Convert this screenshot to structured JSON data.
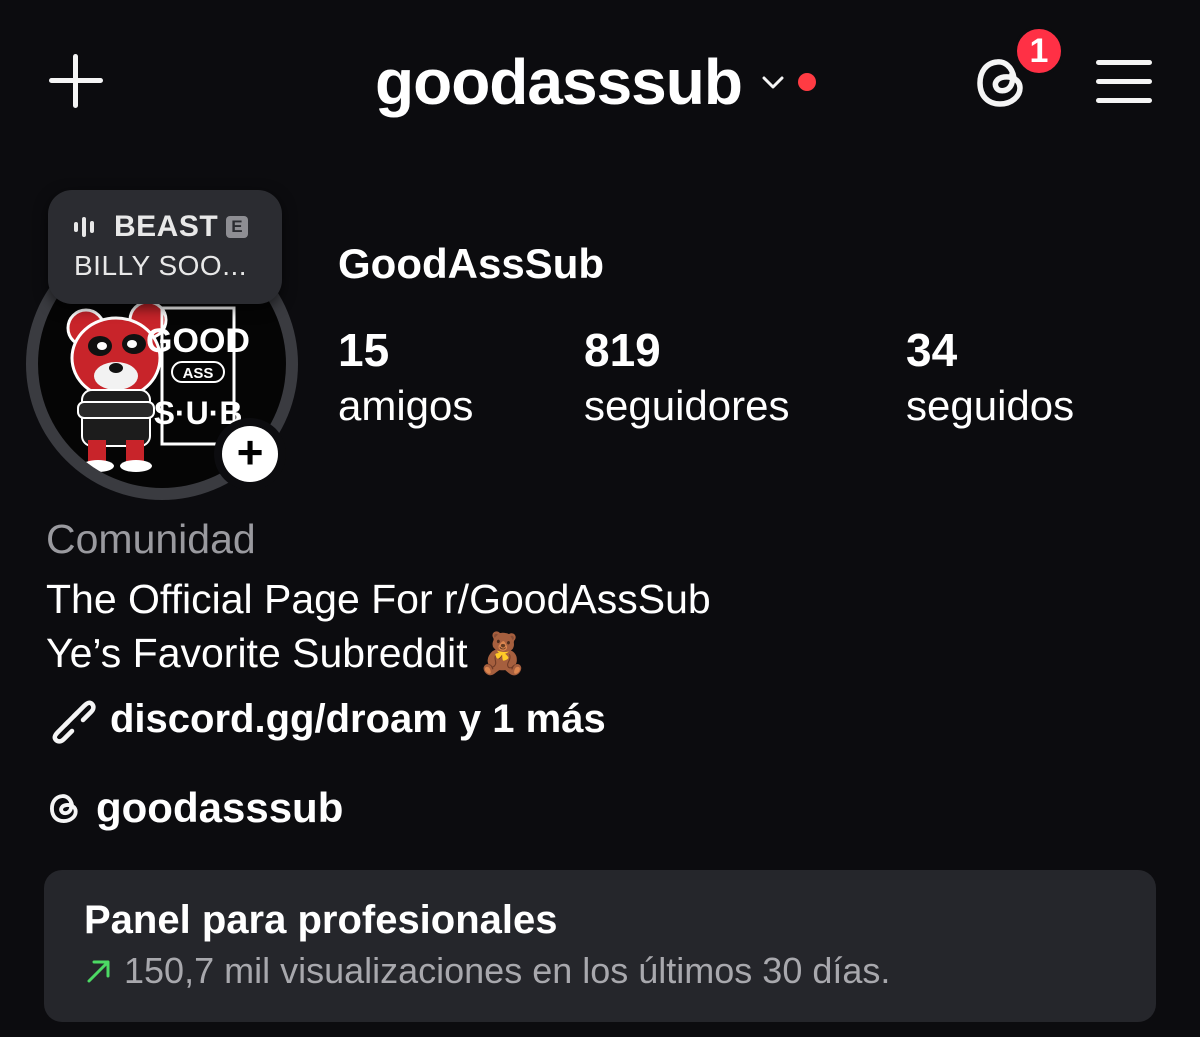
{
  "header": {
    "username": "goodasssub",
    "notification_count": "1",
    "colors": {
      "notification": "#ff3045",
      "status_dot": "#ff3b43"
    },
    "icons": [
      "plus-icon",
      "chevron-down-icon",
      "threads-icon",
      "hamburger-menu-icon"
    ]
  },
  "music_note": {
    "title": "BEAST",
    "explicit_badge": "E",
    "artist": "BILLY SOO..."
  },
  "profile": {
    "display_name": "GoodAssSub",
    "stats": [
      {
        "value": "15",
        "label": "amigos"
      },
      {
        "value": "819",
        "label": "seguidores"
      },
      {
        "value": "34",
        "label": "seguidos"
      }
    ],
    "avatar_text": {
      "line1": "GOOD",
      "line2": "ASS",
      "line3": "S·U·B"
    }
  },
  "bio": {
    "category": "Comunidad",
    "line1": "The Official Page For r/GoodAssSub",
    "line2": "Ye’s Favorite Subreddit",
    "emoji": "🧸",
    "link": "discord.gg/droam y 1 más",
    "threads_handle": "goodasssub"
  },
  "dashboard": {
    "title": "Panel para profesionales",
    "subtitle": "150,7 mil visualizaciones en los últimos 30 días.",
    "colors": {
      "trend_arrow": "#4cd964"
    }
  }
}
